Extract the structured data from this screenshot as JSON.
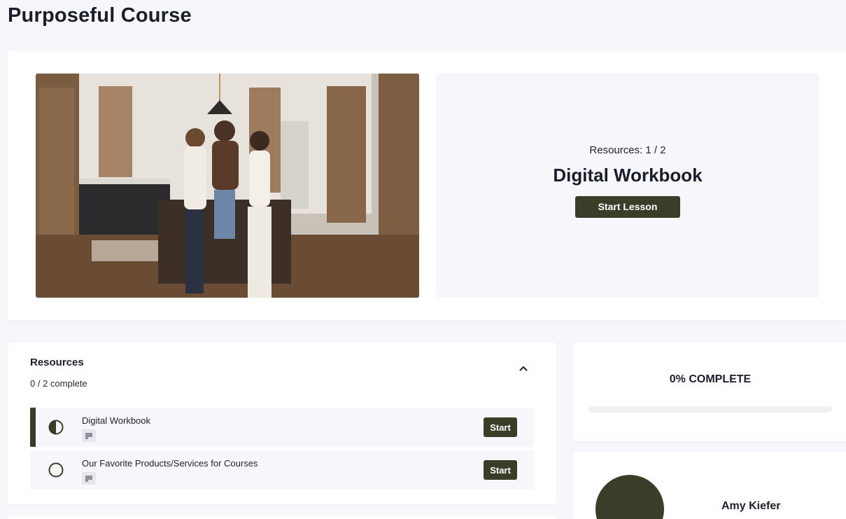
{
  "page": {
    "title": "Purposeful Course"
  },
  "hero": {
    "image_alt": "Three women sitting on a kitchen island",
    "resources_count": "Resources: 1 / 2",
    "current_lesson": "Digital Workbook",
    "start_lesson_label": "Start Lesson"
  },
  "resources": {
    "title": "Resources",
    "progress_text": "0 / 2 complete",
    "collapse_icon": "chevron-up-icon",
    "items": [
      {
        "label": "Digital Workbook",
        "status_icon": "half-circle-icon",
        "type_icon": "text-lesson-icon",
        "button": "Start",
        "active": true
      },
      {
        "label": "Our Favorite Products/Services for Courses",
        "status_icon": "empty-circle-icon",
        "type_icon": "text-lesson-icon",
        "button": "Start",
        "active": false
      }
    ]
  },
  "progress": {
    "label": "0% COMPLETE",
    "percent": 0
  },
  "author": {
    "name": "Amy Kiefer"
  },
  "colors": {
    "accent": "#3a3d28",
    "background": "#f6f7fa",
    "card": "#ffffff"
  }
}
